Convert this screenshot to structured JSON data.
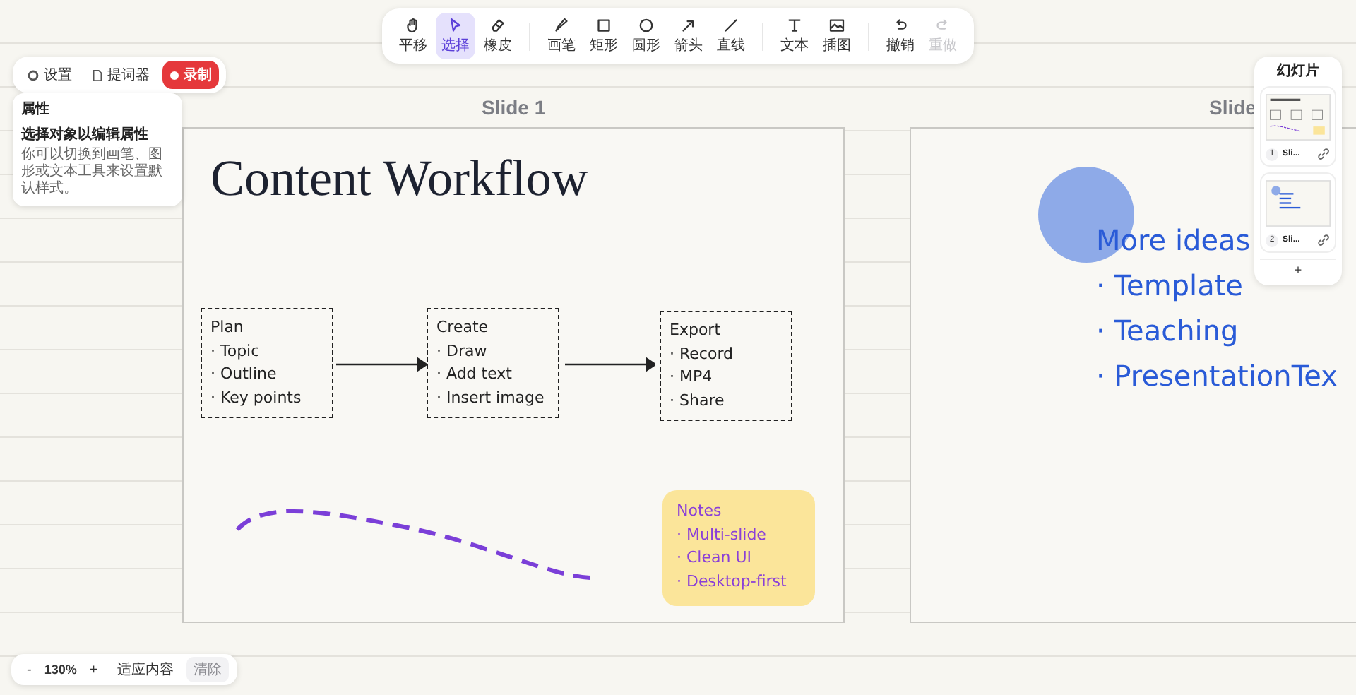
{
  "top_buttons": [
    {
      "label": "设置",
      "kind": "plain"
    },
    {
      "label": "提词器",
      "kind": "plain"
    },
    {
      "label": "录制",
      "kind": "record"
    }
  ],
  "properties": {
    "title": "属性",
    "heading": "选择对象以编辑属性",
    "hint": "你可以切换到画笔、图形或文本工具来设置默认样式。"
  },
  "toolbar": {
    "tools": [
      {
        "label": "平移",
        "selected": false,
        "disabled": false
      },
      {
        "label": "选择",
        "selected": true,
        "disabled": false
      },
      {
        "label": "橡皮",
        "selected": false,
        "disabled": false
      },
      {
        "label": "画笔",
        "selected": false,
        "disabled": false
      },
      {
        "label": "矩形",
        "selected": false,
        "disabled": false
      },
      {
        "label": "圆形",
        "selected": false,
        "disabled": false
      },
      {
        "label": "箭头",
        "selected": false,
        "disabled": false
      },
      {
        "label": "直线",
        "selected": false,
        "disabled": false
      },
      {
        "label": "文本",
        "selected": false,
        "disabled": false
      },
      {
        "label": "插图",
        "selected": false,
        "disabled": false
      },
      {
        "label": "撤销",
        "selected": false,
        "disabled": false
      },
      {
        "label": "重做",
        "selected": false,
        "disabled": true
      }
    ]
  },
  "slides": [
    {
      "title": "Slide 1",
      "heading": "Content Workflow",
      "boxes": [
        {
          "title": "Plan",
          "items": [
            "· Topic",
            "· Outline",
            "· Key points"
          ]
        },
        {
          "title": "Create",
          "items": [
            "· Draw",
            "· Add text",
            "· Insert image"
          ]
        },
        {
          "title": "Export",
          "items": [
            "· Record",
            "· MP4",
            "· Share"
          ]
        }
      ],
      "note": {
        "title": "Notes",
        "items": [
          "· Multi-slide",
          "· Clean UI",
          "· Desktop-first"
        ]
      }
    },
    {
      "title": "Slide",
      "lines": [
        "More ideas",
        "· Template",
        "· Teaching",
        "· PresentationTex"
      ]
    }
  ],
  "slide_panel": {
    "title": "幻灯片",
    "items": [
      {
        "number": "1",
        "name": "Sli..."
      },
      {
        "number": "2",
        "name": "Sli..."
      }
    ],
    "add": "+"
  },
  "zoom_bar": {
    "zoom_out": "-",
    "zoom": "130%",
    "zoom_in": "+",
    "fit": "适应内容",
    "clear": {
      "label": "清除",
      "disabled": true
    }
  }
}
